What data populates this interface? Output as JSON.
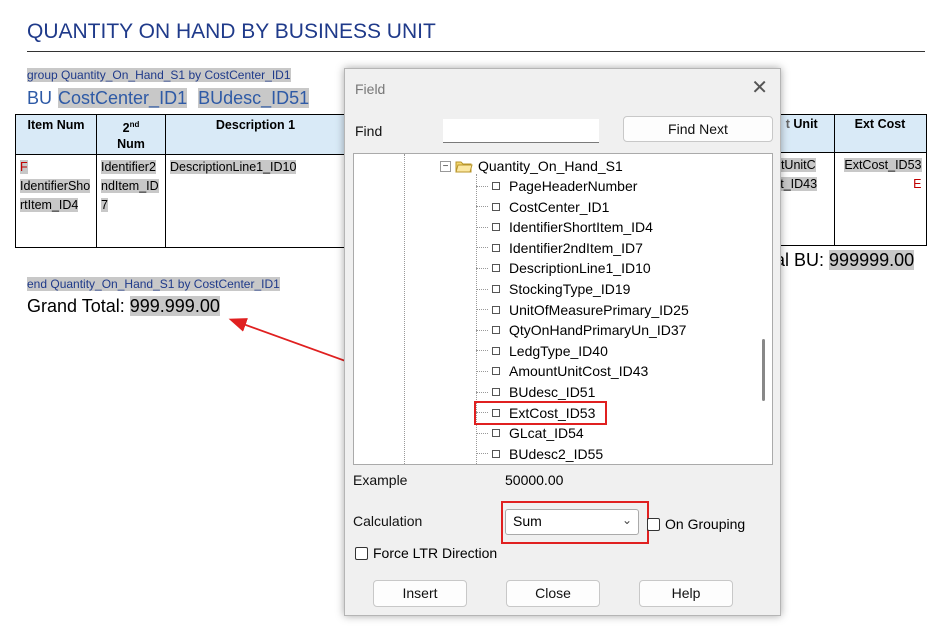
{
  "report": {
    "title": "QUANTITY ON HAND BY BUSINESS UNIT",
    "group_line": "group Quantity_On_Hand_S1 by CostCenter_ID1",
    "bu_label": "BU",
    "bu_field1": "CostCenter_ID1",
    "bu_field2": "BUdesc_ID51",
    "table": {
      "headers": [
        "Item Num",
        "2nd Num",
        "Description 1"
      ],
      "header_2nd_sup": "nd",
      "header_2nd_pre": "2",
      "header_2nd_post": " Num",
      "cells": {
        "item_prefix": "F",
        "item": "IdentifierShortItem_ID4",
        "num2": "Identifier2ndItem_ID7",
        "desc": "DescriptionLine1_ID10"
      },
      "right_headers": [
        "Unit",
        "Ext Cost"
      ],
      "right_cells": {
        "unit": "ntUnitC st_ID43",
        "ext": "ExtCost_ID53",
        "ext_suffix": "E"
      }
    },
    "total_bu_label": "al BU:",
    "total_bu_value": "999999.00",
    "end_line": "end Quantity_On_Hand_S1 by CostCenter_ID1",
    "grand_total_label": "Grand Total:",
    "grand_total_value": "999.999.00"
  },
  "dialog": {
    "title": "Field",
    "find_label": "Find",
    "find_value": "",
    "find_next": "Find Next",
    "tree_root": "Quantity_On_Hand_S1",
    "tree_items": [
      "PageHeaderNumber",
      "CostCenter_ID1",
      "IdentifierShortItem_ID4",
      "Identifier2ndItem_ID7",
      "DescriptionLine1_ID10",
      "StockingType_ID19",
      "UnitOfMeasurePrimary_ID25",
      "QtyOnHandPrimaryUn_ID37",
      "LedgType_ID40",
      "AmountUnitCost_ID43",
      "BUdesc_ID51",
      "ExtCost_ID53",
      "GLcat_ID54",
      "BUdesc2_ID55"
    ],
    "selected_item": "ExtCost_ID53",
    "example_label": "Example",
    "example_value": "50000.00",
    "calculation_label": "Calculation",
    "calculation_value": "Sum",
    "on_grouping": "On Grouping",
    "force_ltr": "Force LTR Direction",
    "insert": "Insert",
    "close": "Close",
    "help": "Help"
  },
  "colors": {
    "highlight": "#e02020",
    "title_blue": "#1f3a8a",
    "header_fill": "#d9eaf7"
  }
}
